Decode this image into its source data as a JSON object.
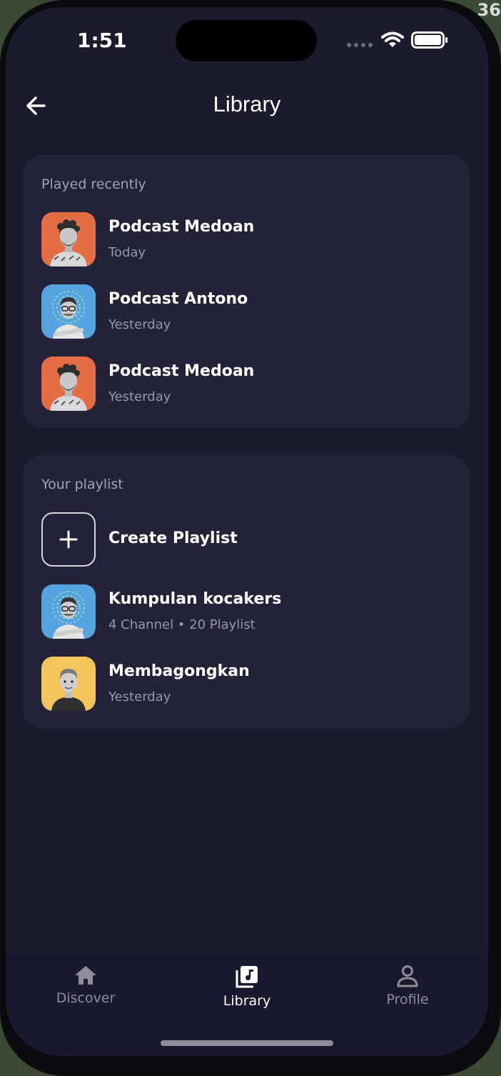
{
  "background_corner_text": "36",
  "status_bar": {
    "time": "1:51"
  },
  "header": {
    "title": "Library",
    "back_icon": "arrow-left-icon"
  },
  "recent": {
    "title": "Played recently",
    "items": [
      {
        "title": "Podcast Medoan",
        "subtitle": "Today",
        "thumb_color": "#e46d44",
        "avatar": "curly-man"
      },
      {
        "title": "Podcast Antono",
        "subtitle": "Yesterday",
        "thumb_color": "#57a3e0",
        "avatar": "glasses-man"
      },
      {
        "title": "Podcast Medoan",
        "subtitle": "Yesterday",
        "thumb_color": "#e46d44",
        "avatar": "curly-man"
      }
    ]
  },
  "playlist": {
    "title": "Your playlist",
    "create_label": "Create Playlist",
    "create_icon": "plus-icon",
    "items": [
      {
        "title": "Kumpulan kocakers",
        "subtitle": "4 Channel • 20 Playlist",
        "thumb_color": "#57a3e0",
        "avatar": "glasses-man"
      },
      {
        "title": "Membagongkan",
        "subtitle": "Yesterday",
        "thumb_color": "#f4c55a",
        "avatar": "young-man"
      }
    ]
  },
  "tabbar": {
    "tabs": [
      {
        "label": "Discover",
        "icon": "home-icon",
        "active": false
      },
      {
        "label": "Library",
        "icon": "library-music-icon",
        "active": true
      },
      {
        "label": "Profile",
        "icon": "profile-icon",
        "active": false
      }
    ]
  },
  "colors": {
    "screen_bg": "#1c1b2d",
    "card_bg": "#232238",
    "tabbar_bg": "#1a1930",
    "text_primary": "#ffffff",
    "text_secondary": "#9897a6",
    "tab_inactive": "#8e8d99"
  }
}
